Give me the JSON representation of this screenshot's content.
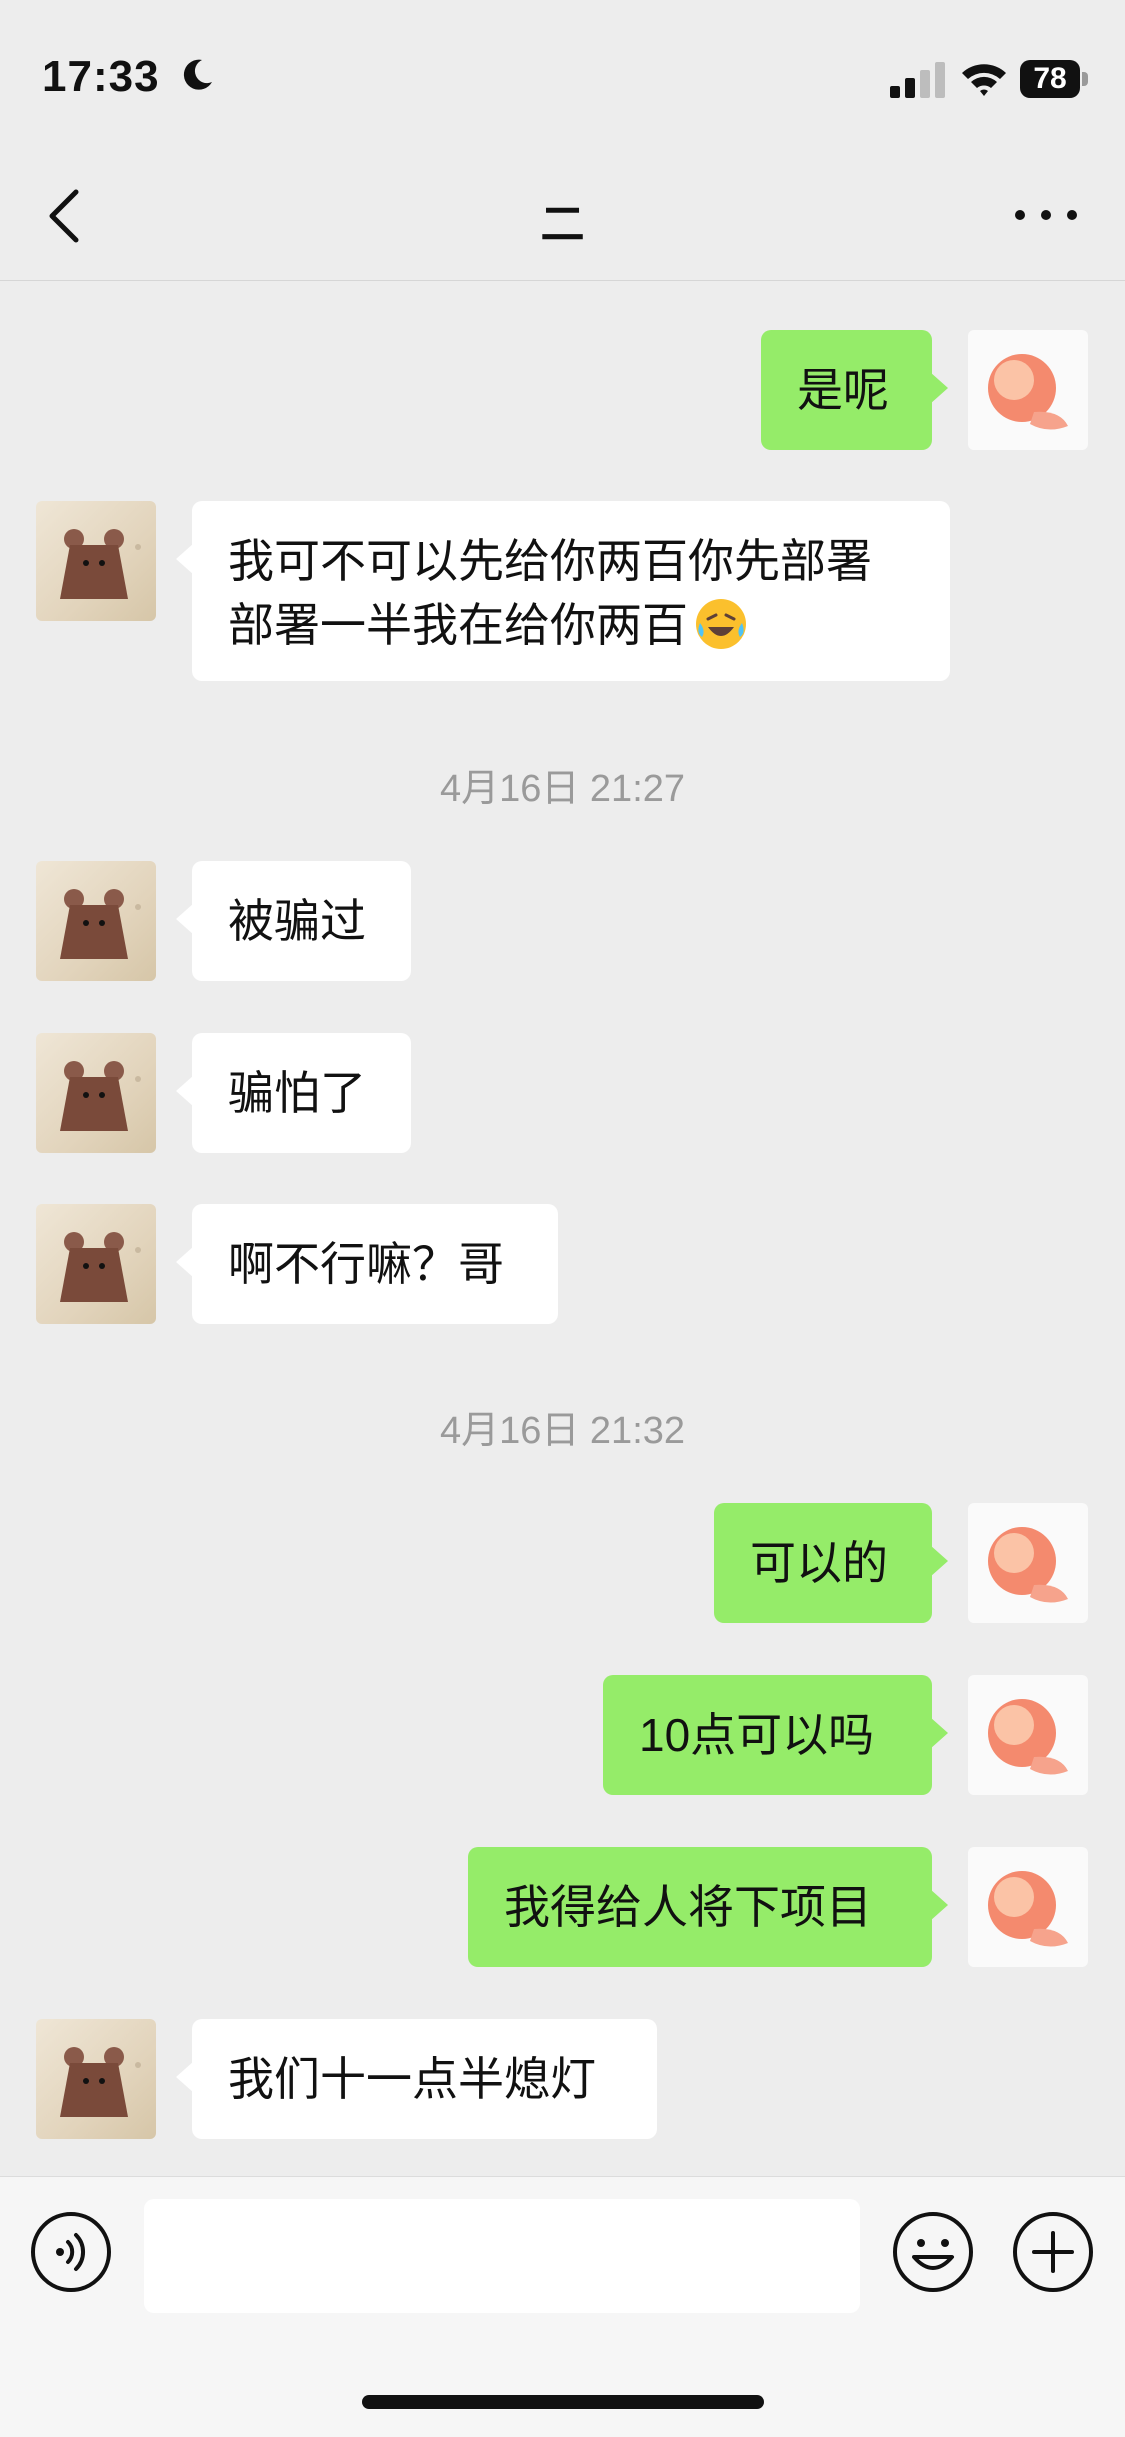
{
  "status_bar": {
    "time": "17:33",
    "battery": "78",
    "icons": [
      "moon-icon",
      "signal-icon",
      "wifi-icon",
      "battery-icon"
    ]
  },
  "nav": {
    "title": "二",
    "back_icon": "chevron-left-icon",
    "more_icon": "ellipsis-icon"
  },
  "messages": [
    {
      "side": "out",
      "text": "是呢"
    },
    {
      "side": "in",
      "line1": "我可不可以先给你两百你先部署",
      "line2": "部署一半我在给你两百",
      "emoji": "laughing-tears-emoji"
    },
    {
      "type": "time",
      "text": "4月16日 21:27"
    },
    {
      "side": "in",
      "text": "被骗过"
    },
    {
      "side": "in",
      "text": "骗怕了"
    },
    {
      "side": "in",
      "text": "啊不行嘛？哥"
    },
    {
      "type": "time",
      "text": "4月16日 21:32"
    },
    {
      "side": "out",
      "text": "可以的"
    },
    {
      "side": "out",
      "text": "10点可以吗"
    },
    {
      "side": "out",
      "text": "我得给人将下项目"
    },
    {
      "side": "in",
      "text": "我们十一点半熄灯"
    }
  ],
  "input_bar": {
    "placeholder": "",
    "value": "",
    "icons": [
      "voice-icon",
      "emoji-icon",
      "plus-icon"
    ]
  },
  "colors": {
    "background": "#ededed",
    "outgoing_bubble": "#95ec69",
    "incoming_bubble": "#ffffff",
    "timestamp": "#9a9a9a"
  }
}
